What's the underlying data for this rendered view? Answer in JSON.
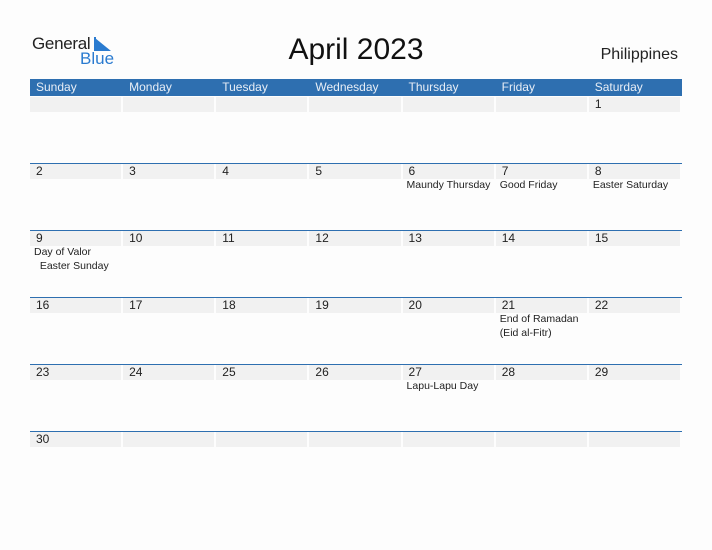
{
  "logo": {
    "general": "General",
    "blue": "Blue"
  },
  "title": "April 2023",
  "country": "Philippines",
  "colors": {
    "header_bg": "#2e6fb0",
    "day_bg": "#f1f1f1",
    "brand_blue": "#2a7bd0"
  },
  "weekdays": [
    "Sunday",
    "Monday",
    "Tuesday",
    "Wednesday",
    "Thursday",
    "Friday",
    "Saturday"
  ],
  "weeks": [
    [
      {
        "day": ""
      },
      {
        "day": ""
      },
      {
        "day": ""
      },
      {
        "day": ""
      },
      {
        "day": ""
      },
      {
        "day": ""
      },
      {
        "day": "1"
      }
    ],
    [
      {
        "day": "2"
      },
      {
        "day": "3"
      },
      {
        "day": "4"
      },
      {
        "day": "5"
      },
      {
        "day": "6",
        "event": "Maundy Thursday"
      },
      {
        "day": "7",
        "event": "Good Friday"
      },
      {
        "day": "8",
        "event": "Easter Saturday"
      }
    ],
    [
      {
        "day": "9",
        "event": "Day of Valor\n  Easter Sunday"
      },
      {
        "day": "10"
      },
      {
        "day": "11"
      },
      {
        "day": "12"
      },
      {
        "day": "13"
      },
      {
        "day": "14"
      },
      {
        "day": "15"
      }
    ],
    [
      {
        "day": "16"
      },
      {
        "day": "17"
      },
      {
        "day": "18"
      },
      {
        "day": "19"
      },
      {
        "day": "20"
      },
      {
        "day": "21",
        "event": "End of Ramadan\n(Eid al-Fitr)"
      },
      {
        "day": "22"
      }
    ],
    [
      {
        "day": "23"
      },
      {
        "day": "24"
      },
      {
        "day": "25"
      },
      {
        "day": "26"
      },
      {
        "day": "27",
        "event": "Lapu-Lapu Day"
      },
      {
        "day": "28"
      },
      {
        "day": "29"
      }
    ],
    [
      {
        "day": "30"
      },
      {
        "day": ""
      },
      {
        "day": ""
      },
      {
        "day": ""
      },
      {
        "day": ""
      },
      {
        "day": ""
      },
      {
        "day": ""
      }
    ]
  ]
}
